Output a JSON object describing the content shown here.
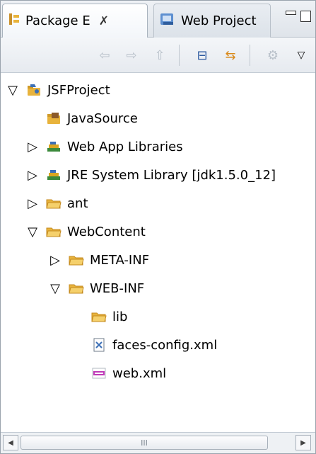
{
  "tabs": [
    {
      "label": "Package E",
      "close": "✗",
      "icon": "package-explorer-icon"
    },
    {
      "label": "Web Project",
      "icon": "web-project-icon"
    }
  ],
  "toolbar": {
    "back": "⇦",
    "forward": "⇨",
    "up": "⇧",
    "collapse_all": "⊟",
    "link": "⇆",
    "filters": "⚙",
    "menu": "▽"
  },
  "tree": [
    {
      "label": "JSFProject",
      "twisty": "▽",
      "icon": "project-icon"
    },
    {
      "label": "JavaSource",
      "twisty": "",
      "icon": "source-folder-icon"
    },
    {
      "label": "Web App Libraries",
      "twisty": "▷",
      "icon": "library-icon"
    },
    {
      "label": "JRE System Library [jdk1.5.0_12]",
      "twisty": "▷",
      "icon": "library-icon"
    },
    {
      "label": "ant",
      "twisty": "▷",
      "icon": "folder-icon"
    },
    {
      "label": "WebContent",
      "twisty": "▽",
      "icon": "folder-icon"
    },
    {
      "label": "META-INF",
      "twisty": "▷",
      "icon": "folder-icon"
    },
    {
      "label": "WEB-INF",
      "twisty": "▽",
      "icon": "folder-icon"
    },
    {
      "label": "lib",
      "twisty": "",
      "icon": "folder-icon"
    },
    {
      "label": "faces-config.xml",
      "twisty": "",
      "icon": "xml-file-icon"
    },
    {
      "label": "web.xml",
      "twisty": "",
      "icon": "web-xml-icon"
    }
  ],
  "scrollbar": {
    "left_arrow": "◀",
    "right_arrow": "▶",
    "grip": "III"
  },
  "colors": {
    "folder": "#e8b33c",
    "library": "#d9a520",
    "project": "#3b6fb6",
    "accent": "#9aa3ad"
  }
}
